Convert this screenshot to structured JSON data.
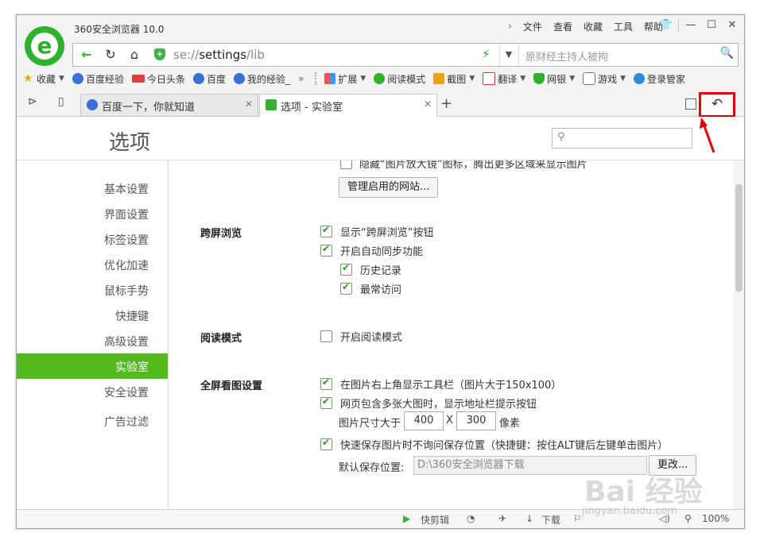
{
  "window": {
    "title": "360安全浏览器 10.0"
  },
  "menu": [
    "文件",
    "查看",
    "收藏",
    "工具",
    "帮助"
  ],
  "toolbar": {
    "url_prefix": "se://",
    "url_main": "settings",
    "url_suffix": "/lib",
    "search_placeholder": "原财经主持人被拘"
  },
  "favorites": [
    {
      "label": "收藏",
      "icon": "star-icon"
    },
    {
      "label": "百度经验",
      "icon": "baidu-paw-icon"
    },
    {
      "label": "今日头条",
      "icon": "toutiao-icon"
    },
    {
      "label": "百度",
      "icon": "baidu-paw-icon"
    },
    {
      "label": "我的经验_",
      "icon": "baidu-paw-icon"
    }
  ],
  "extensions": [
    {
      "label": "扩展",
      "icon": "extension-grid-icon"
    },
    {
      "label": "阅读模式",
      "icon": "read-mode-icon"
    },
    {
      "label": "截图",
      "icon": "scissors-icon"
    },
    {
      "label": "翻译",
      "icon": "translate-icon"
    },
    {
      "label": "网银",
      "icon": "bank-shield-icon"
    },
    {
      "label": "游戏",
      "icon": "game-icon"
    },
    {
      "label": "登录管家",
      "icon": "login-manager-icon"
    }
  ],
  "tabs": [
    {
      "title": "百度一下，你就知道"
    },
    {
      "title": "选项 - 实验室"
    }
  ],
  "page": {
    "title": "选项"
  },
  "sidebar": {
    "items": [
      "基本设置",
      "界面设置",
      "标签设置",
      "优化加速",
      "鼠标手势",
      "快捷键",
      "高级设置",
      "实验室",
      "安全设置",
      "广告过滤"
    ],
    "active": "实验室"
  },
  "settings": {
    "magnifier": {
      "label": "隐藏“图片放大镜”图标，腾出更多区域来显示图片",
      "manage_button": "管理启用的网站..."
    },
    "crossscreen": {
      "title": "跨屏浏览",
      "show_button": "显示“跨屏浏览”按钮",
      "auto_sync": "开启自动同步功能",
      "history": "历史记录",
      "frequent": "最常访问"
    },
    "reading": {
      "title": "阅读模式",
      "enable": "开启阅读模式"
    },
    "fullscreen_image": {
      "title": "全屏看图设置",
      "toolbar": "在图片右上角显示工具栏（图片大于150x100）",
      "addressbar_hint": "网页包含多张大图时，显示地址栏提示按钮",
      "size_prefix": "图片尺寸大于",
      "width": "400",
      "x": "X",
      "height": "300",
      "unit": "像素",
      "quick_save": "快速保存图片时不询问保存位置（快捷键：按住ALT键后左键单击图片）",
      "save_location_label": "默认保存位置:",
      "save_location": "D:\\360安全浏览器下载",
      "change_button": "更改..."
    }
  },
  "status": {
    "clip": "快剪辑",
    "download": "下载",
    "zoom": "100%"
  },
  "watermark": {
    "brand": "Bai 经验",
    "site": "jingyan.baidu.com"
  }
}
